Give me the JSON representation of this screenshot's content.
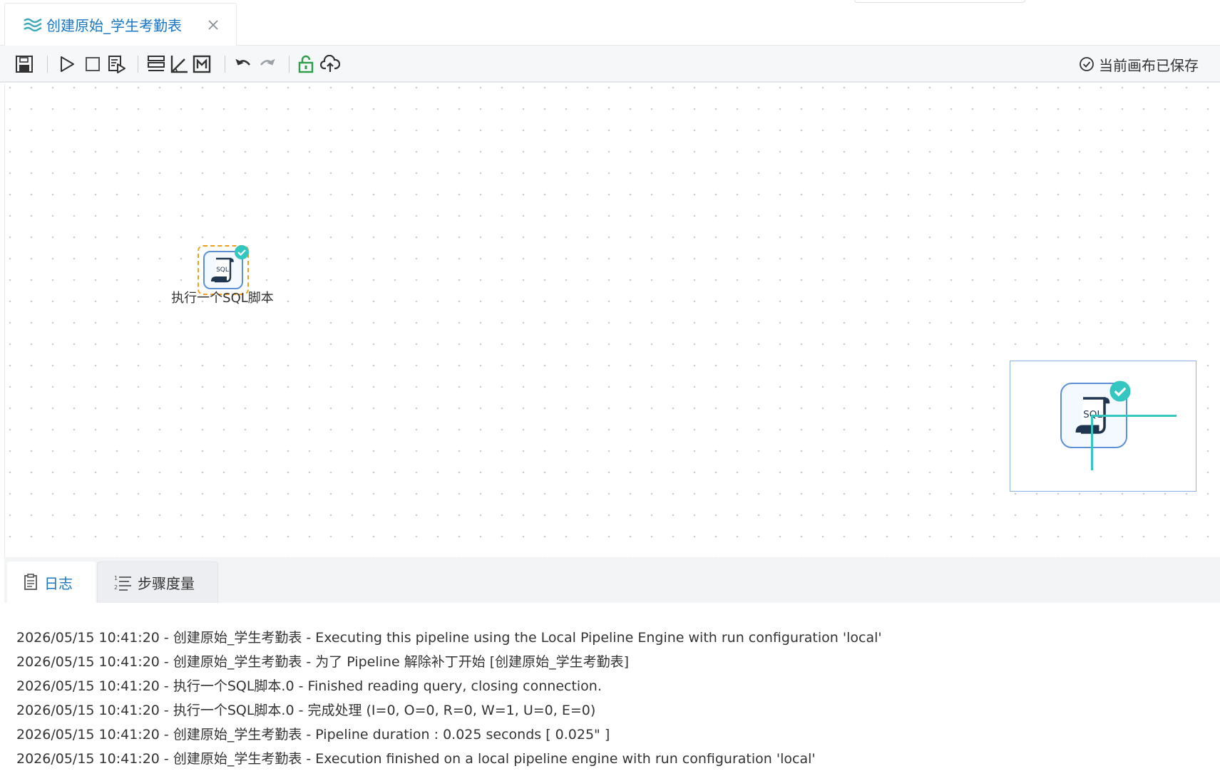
{
  "tab": {
    "title": "创建原始_学生考勤表",
    "icon": "pipeline-wave-icon"
  },
  "toolbar": {
    "buttons": [
      {
        "name": "save-button",
        "icon": "save-icon"
      },
      {
        "name": "run-button",
        "icon": "play-icon"
      },
      {
        "name": "stop-button",
        "icon": "stop-icon"
      },
      {
        "name": "preview-button",
        "icon": "preview-icon"
      },
      {
        "name": "align-button",
        "icon": "align-icon"
      },
      {
        "name": "snap-button",
        "icon": "angle-icon"
      },
      {
        "name": "metrics-button",
        "icon": "metric-icon"
      },
      {
        "name": "undo-button",
        "icon": "undo-icon"
      },
      {
        "name": "redo-button",
        "icon": "redo-icon"
      },
      {
        "name": "lock-button",
        "icon": "unlock-icon"
      },
      {
        "name": "upload-button",
        "icon": "cloud-upload-icon"
      }
    ],
    "saved_status": "当前画布已保存"
  },
  "canvas": {
    "node": {
      "label": "执行一个SQL脚本",
      "icon_text": "SQL",
      "status": "success"
    },
    "minimap": {
      "icon_text": "SQL"
    }
  },
  "panel": {
    "tabs": [
      {
        "label": "日志",
        "icon": "log-icon",
        "active": true
      },
      {
        "label": "步骤度量",
        "icon": "ordered-list-icon",
        "active": false
      }
    ],
    "logs": [
      "2026/05/15 10:41:20 - 创建原始_学生考勤表 - Executing this pipeline using the Local Pipeline Engine with run configuration 'local'",
      "2026/05/15 10:41:20 - 创建原始_学生考勤表 - 为了 Pipeline 解除补丁开始 [创建原始_学生考勤表]",
      "2026/05/15 10:41:20 - 执行一个SQL脚本.0 - Finished reading query, closing connection.",
      "2026/05/15 10:41:20 - 执行一个SQL脚本.0 - 完成处理 (I=0, O=0, R=0, W=1, U=0, E=0)",
      "2026/05/15 10:41:20 - 创建原始_学生考勤表 - Pipeline duration : 0.025 seconds [  0.025\" ]",
      "2026/05/15 10:41:20 - 创建原始_学生考勤表 - Execution finished on a local pipeline engine with run configuration 'local'"
    ]
  },
  "colors": {
    "accent": "#1976c2",
    "node_border": "#5b8fd6",
    "selection": "#f0a020",
    "success": "#34c6c0"
  }
}
